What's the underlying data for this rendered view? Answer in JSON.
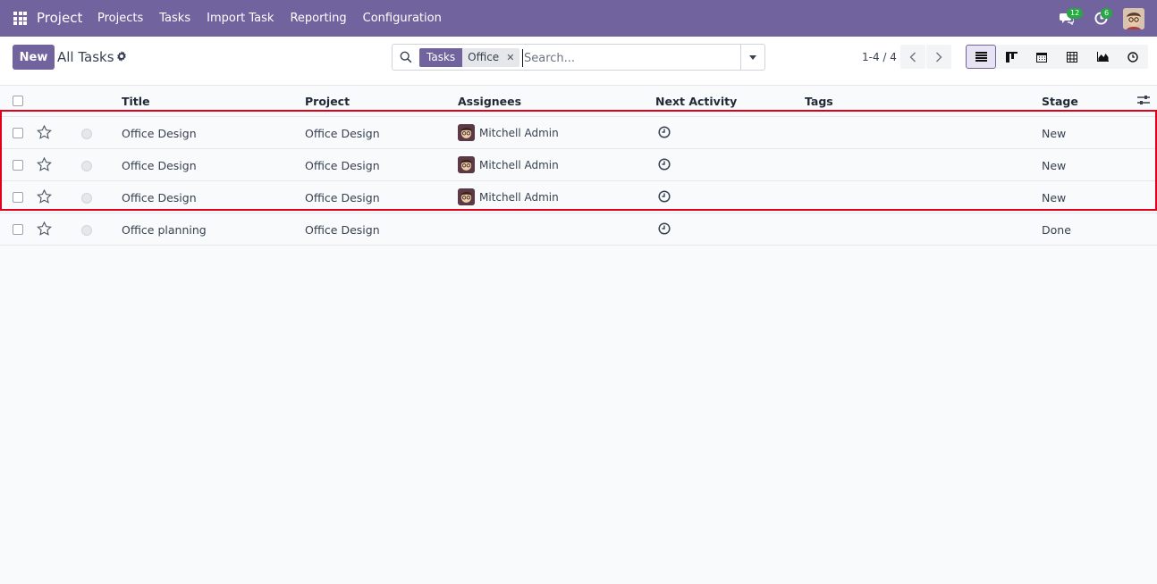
{
  "navbar": {
    "brand": "Project",
    "menu": [
      "Projects",
      "Tasks",
      "Import Task",
      "Reporting",
      "Configuration"
    ],
    "messages_count": "12",
    "activities_count": "6"
  },
  "control": {
    "new_label": "New",
    "title": "All Tasks",
    "facet_label": "Tasks",
    "facet_value": "Office",
    "search_placeholder": "Search...",
    "pager": "1-4 / 4"
  },
  "columns": [
    "Title",
    "Project",
    "Assignees",
    "Next Activity",
    "Tags",
    "Stage"
  ],
  "rows": [
    {
      "title": "Office Design",
      "project": "Office Design",
      "assignee": "Mitchell Admin",
      "tags": "",
      "stage": "New"
    },
    {
      "title": "Office Design",
      "project": "Office Design",
      "assignee": "Mitchell Admin",
      "tags": "",
      "stage": "New"
    },
    {
      "title": "Office Design",
      "project": "Office Design",
      "assignee": "Mitchell Admin",
      "tags": "",
      "stage": "New"
    },
    {
      "title": "Office planning",
      "project": "Office Design",
      "assignee": "",
      "tags": "",
      "stage": "Done"
    }
  ],
  "colors": {
    "brand": "#71639e",
    "highlight": "#e0001b",
    "badge": "#28a745"
  }
}
